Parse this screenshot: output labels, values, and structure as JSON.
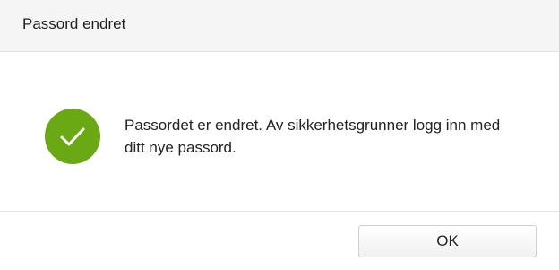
{
  "dialog": {
    "title": "Passord endret",
    "message": "Passordet er endret. Av sikkerhetsgrunner logg inn med ditt nye passord.",
    "icon": "checkmark-circle-icon",
    "ok_label": "OK",
    "colors": {
      "success": "#6aa814",
      "header_bg": "#f5f5f5"
    }
  }
}
